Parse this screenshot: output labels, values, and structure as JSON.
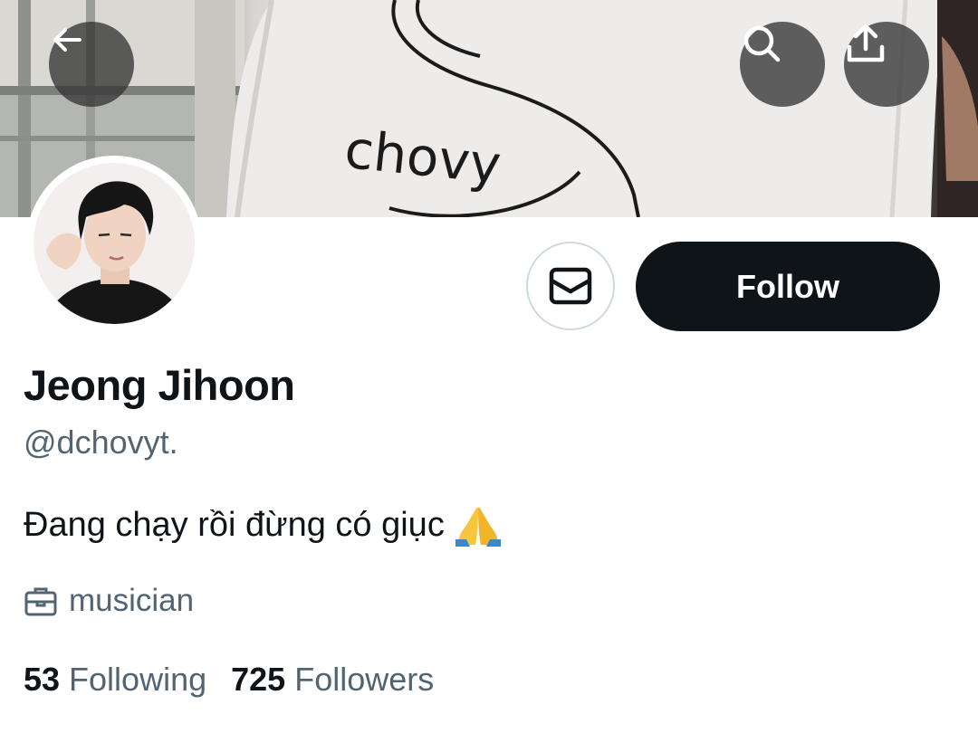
{
  "header": {
    "shirt_text": "chovy",
    "back_icon": "arrow-left-icon",
    "search_icon": "search-icon",
    "share_icon": "share-upload-icon"
  },
  "profile": {
    "display_name": "Jeong Jihoon",
    "handle": "@dchovyt.",
    "bio": "Đang chạy rồi đừng có giục",
    "bio_emoji": "folded-hands-emoji",
    "profession": "musician",
    "profession_icon": "briefcase-icon"
  },
  "actions": {
    "message_icon": "envelope-icon",
    "follow_label": "Follow"
  },
  "stats": {
    "following_count": "53",
    "following_label": "Following",
    "followers_count": "725",
    "followers_label": "Followers"
  },
  "colors": {
    "primary_text": "#0f1419",
    "secondary_text": "#536471",
    "follow_bg": "#0f1419",
    "follow_text": "#ffffff",
    "border": "#cfd9de"
  }
}
